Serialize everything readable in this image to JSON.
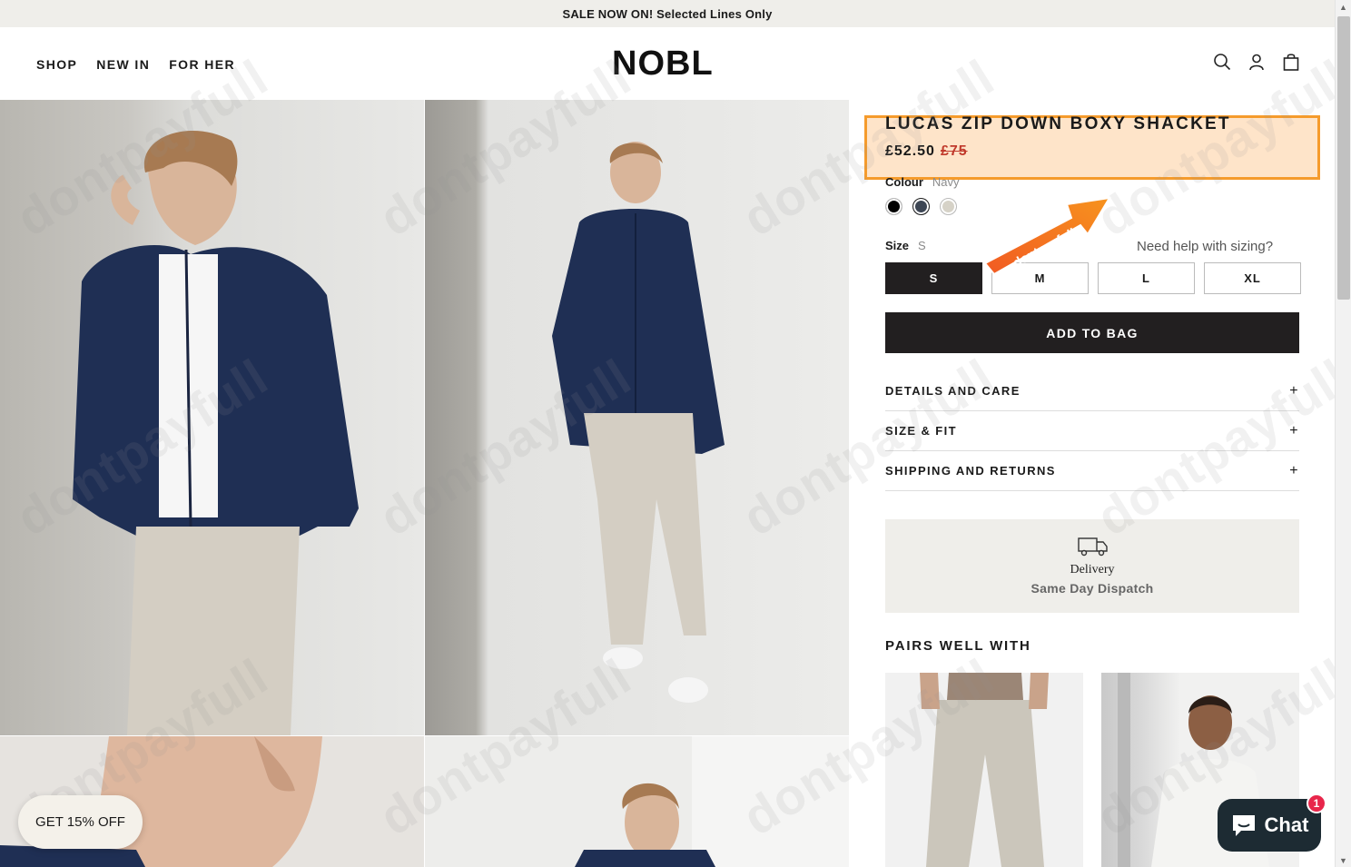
{
  "announcement": "SALE NOW ON! Selected Lines Only",
  "nav": [
    "SHOP",
    "NEW IN",
    "FOR HER"
  ],
  "logo": "NOBL",
  "header_icons": [
    "search-icon",
    "account-icon",
    "bag-icon"
  ],
  "product": {
    "title": "LUCAS ZIP DOWN BOXY SHACKET",
    "price": "£52.50",
    "old_price": "£75",
    "colour_label": "Colour",
    "colour_value": "Navy",
    "swatches": [
      "#000000",
      "#3d4654",
      "#d6d2c7"
    ],
    "size_label": "Size",
    "size_value": "S",
    "size_help": "Need help with sizing?",
    "sizes": [
      "S",
      "M",
      "L",
      "XL"
    ],
    "selected_size": "S",
    "add_to_bag": "ADD TO BAG"
  },
  "accordions": [
    "DETAILS AND CARE",
    "SIZE & FIT",
    "SHIPPING AND RETURNS"
  ],
  "delivery": {
    "title": "Delivery",
    "subtitle": "Same Day Dispatch"
  },
  "pairs_heading": "PAIRS WELL WITH",
  "promo": "GET 15% OFF",
  "chat": {
    "label": "Chat",
    "badge": "1"
  },
  "watermark": "dontpayfull",
  "arrow_text": "dontpayfull",
  "highlight_color": "#f59b2c"
}
